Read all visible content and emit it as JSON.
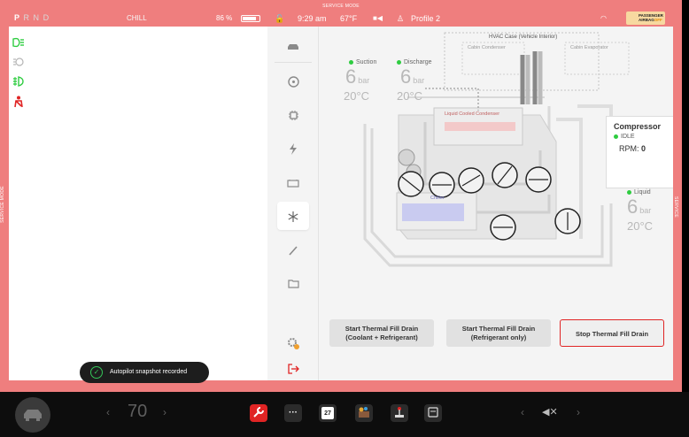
{
  "frame": {
    "service_mode_label": "SERVICE MODE",
    "accent_color": "#ef7e7e"
  },
  "left_status": {
    "gears": [
      "P",
      "R",
      "N",
      "D"
    ],
    "drive_mode": "CHILL",
    "battery_percent": "86 %",
    "battery_level": 0.86
  },
  "indicators": [
    {
      "icon": "headlights-icon",
      "color": "#2ecc40"
    },
    {
      "icon": "parking-lights-icon",
      "color": "#b5b5b5"
    },
    {
      "icon": "fog-lights-icon",
      "color": "#2ecc40"
    },
    {
      "icon": "seatbelt-warning-icon",
      "color": "#e02424"
    }
  ],
  "toast": {
    "text": "Autopilot snapshot recorded"
  },
  "top_bar": {
    "time": "9:29 am",
    "temperature": "67°F",
    "profile": "Profile 2",
    "airbag_line1": "PASSENGER",
    "airbag_line2": "AIRBAG",
    "airbag_state": "OFF"
  },
  "sidebar": {
    "items": [
      {
        "name": "car-icon",
        "glyph": "🚘"
      },
      {
        "name": "steering-wheel-icon",
        "glyph": "◎"
      },
      {
        "name": "chip-icon",
        "glyph": "▣"
      },
      {
        "name": "lightning-icon",
        "glyph": "ϟ"
      },
      {
        "name": "battery-icon",
        "glyph": "▭"
      },
      {
        "name": "snowflake-icon",
        "glyph": "❄"
      },
      {
        "name": "wiper-icon",
        "glyph": "⁄"
      },
      {
        "name": "folder-icon",
        "glyph": "▱"
      }
    ],
    "active_index": 5,
    "settings_glyph": "⚙",
    "exit_glyph": "↦"
  },
  "thermal": {
    "suction_label": "Suction",
    "suction_value": "6",
    "suction_unit": "bar",
    "suction_temp": "20°C",
    "discharge_label": "Discharge",
    "discharge_value": "6",
    "discharge_unit": "bar",
    "discharge_temp": "20°C",
    "hvac_label": "HVAC Case (Vehicle Interior)",
    "cabin_condenser": "Cabin Condenser",
    "cabin_evaporator": "Cabin Evaporator",
    "lcc_label": "Liquid Cooled Condenser",
    "chiller_label": "Chiller",
    "liquid_label": "Liquid",
    "liquid_value": "6",
    "liquid_unit": "bar",
    "liquid_temp": "20°C",
    "compressor_title": "Compressor",
    "compressor_state": "IDLE",
    "compressor_rpm_label": "RPM:",
    "compressor_rpm_value": "0"
  },
  "buttons": {
    "fill_both_line1": "Start Thermal Fill Drain",
    "fill_both_line2": "(Coolant + Refrigerant)",
    "fill_ref_line1": "Start Thermal Fill Drain",
    "fill_ref_line2": "(Refrigerant only)",
    "stop": "Stop Thermal Fill Drain"
  },
  "taskbar": {
    "temp_value": "70",
    "calendar_day": "27",
    "volume_glyph": "◀✕",
    "apps": [
      {
        "name": "service-wrench-icon",
        "color": "#e02424"
      },
      {
        "name": "dots-icon",
        "color": "#2b2b2b"
      },
      {
        "name": "calendar-icon",
        "color": "#2b2b2b"
      },
      {
        "name": "toybox-icon",
        "color": "#2b2b2b"
      },
      {
        "name": "joystick-icon",
        "color": "#2b2b2b"
      },
      {
        "name": "dashcam-icon",
        "color": "#2b2b2b"
      }
    ]
  }
}
